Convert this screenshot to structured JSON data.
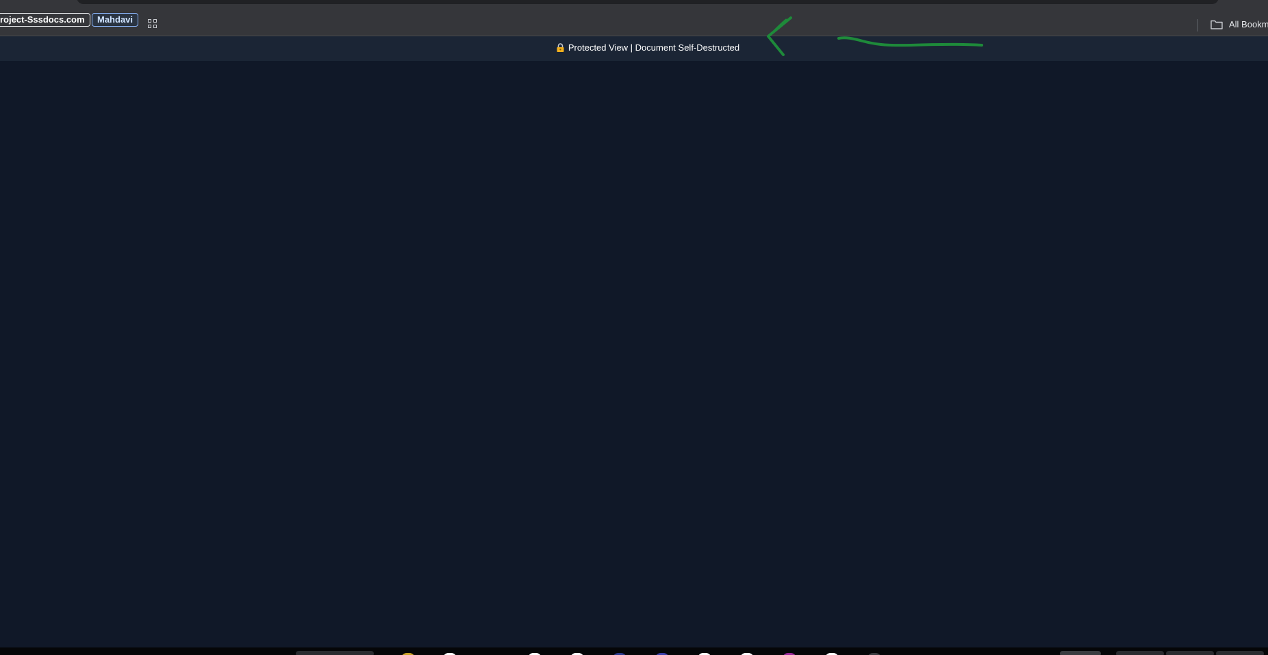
{
  "bookmarks_bar": {
    "items": [
      {
        "label": "roject-Sssdocs.com"
      },
      {
        "label": "Mahdavi"
      }
    ],
    "all_bookmarks_label": "All Bookm"
  },
  "banner": {
    "text": "Protected View | Document Self-Destructed",
    "icon": "lock-icon"
  },
  "colors": {
    "page_background": "#101828",
    "banner_background": "#1b2535",
    "annotation_arrow": "#1e8a3a"
  }
}
